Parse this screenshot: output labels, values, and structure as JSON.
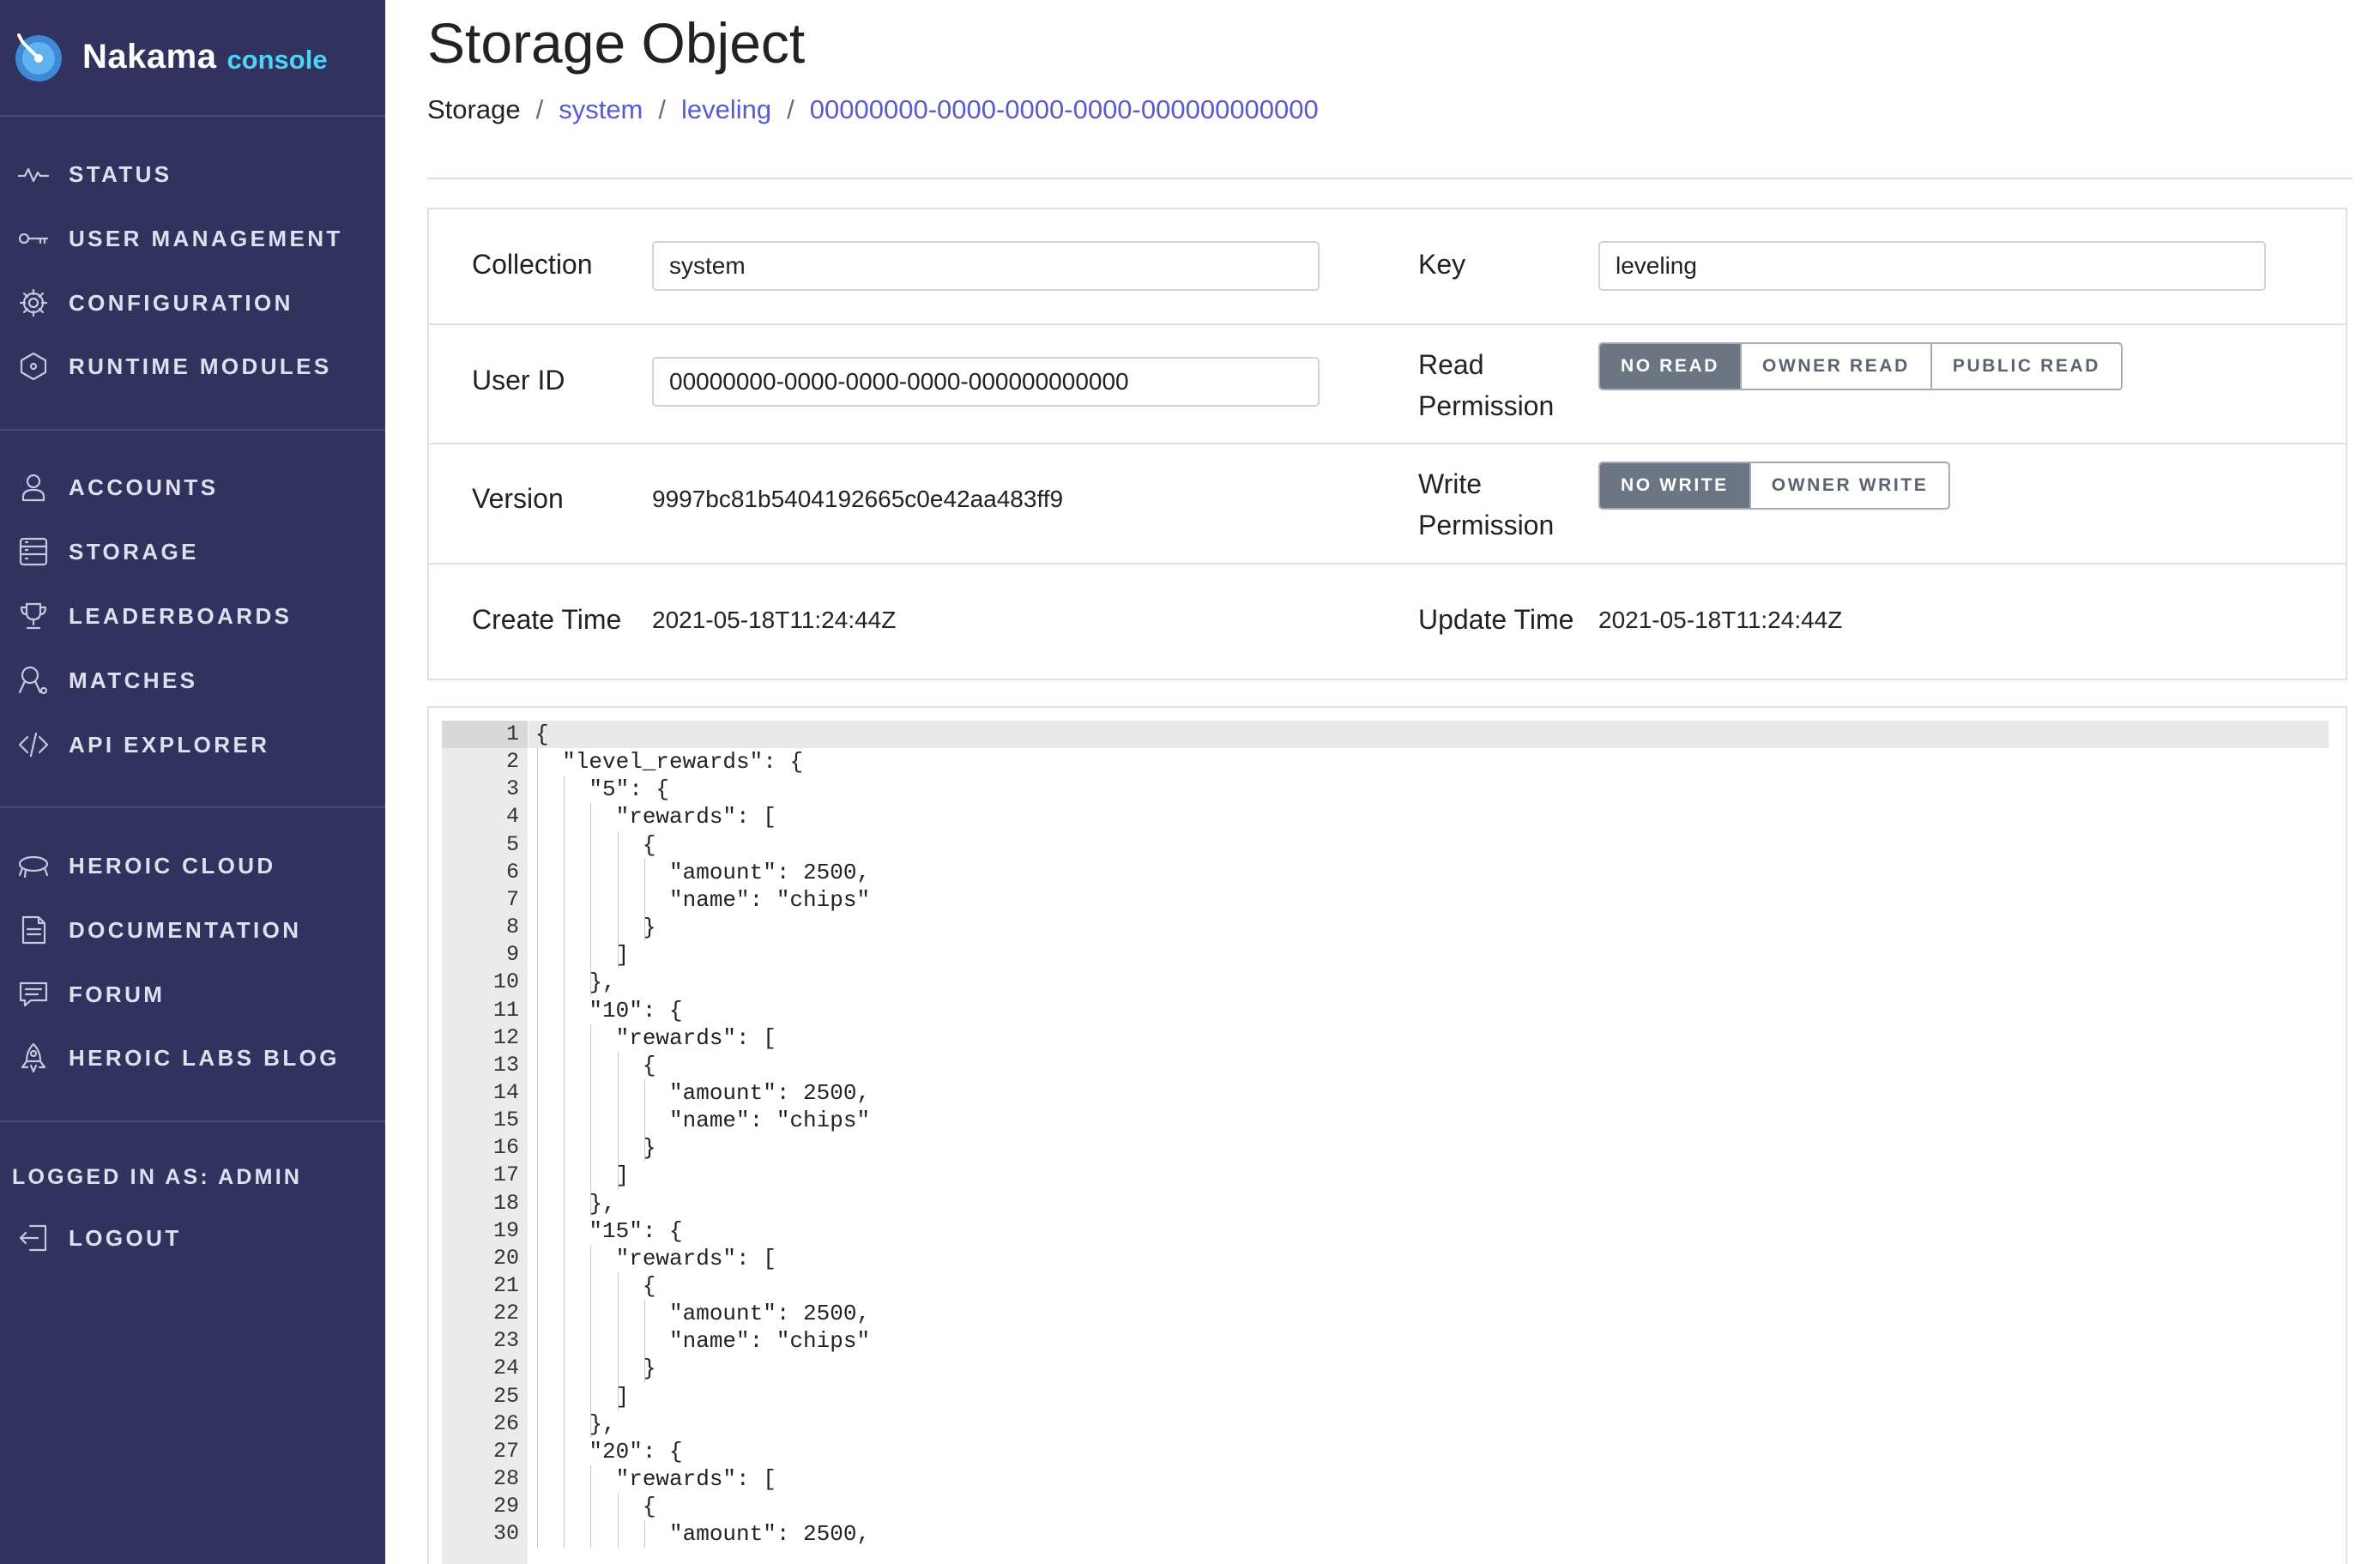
{
  "sidebar": {
    "brand_name": "Nakama",
    "brand_sub": "console",
    "nav_top": [
      {
        "label": "STATUS",
        "icon": "pulse-icon"
      },
      {
        "label": "USER MANAGEMENT",
        "icon": "key-icon"
      },
      {
        "label": "CONFIGURATION",
        "icon": "gear-icon"
      },
      {
        "label": "RUNTIME MODULES",
        "icon": "module-icon"
      }
    ],
    "nav_mid": [
      {
        "label": "ACCOUNTS",
        "icon": "user-icon"
      },
      {
        "label": "STORAGE",
        "icon": "storage-icon"
      },
      {
        "label": "LEADERBOARDS",
        "icon": "trophy-icon"
      },
      {
        "label": "MATCHES",
        "icon": "matches-icon"
      },
      {
        "label": "API EXPLORER",
        "icon": "code-icon"
      }
    ],
    "nav_links": [
      {
        "label": "HEROIC CLOUD",
        "icon": "cloud-icon"
      },
      {
        "label": "DOCUMENTATION",
        "icon": "document-icon"
      },
      {
        "label": "FORUM",
        "icon": "chat-icon"
      },
      {
        "label": "HEROIC LABS BLOG",
        "icon": "rocket-icon"
      }
    ],
    "logged_in": "LOGGED IN AS: ADMIN",
    "logout": "LOGOUT"
  },
  "page": {
    "title": "Storage Object",
    "breadcrumb": {
      "root": "Storage",
      "collection": "system",
      "key": "leveling",
      "user": "00000000-0000-0000-0000-000000000000",
      "separator": "/"
    }
  },
  "form": {
    "collection_label": "Collection",
    "collection_value": "system",
    "key_label": "Key",
    "key_value": "leveling",
    "user_id_label": "User ID",
    "user_id_value": "00000000-0000-0000-0000-000000000000",
    "read_permission_label": [
      "Read",
      "Permission"
    ],
    "read_options": [
      "NO READ",
      "OWNER READ",
      "PUBLIC READ"
    ],
    "read_selected": "NO READ",
    "version_label": "Version",
    "version_value": "9997bc81b5404192665c0e42aa483ff9",
    "write_permission_label": [
      "Write",
      "Permission"
    ],
    "write_options": [
      "NO WRITE",
      "OWNER WRITE"
    ],
    "write_selected": "NO WRITE",
    "create_time_label": "Create Time",
    "create_time_value": "2021-05-18T11:24:44Z",
    "update_time_label": "Update Time",
    "update_time_value": "2021-05-18T11:24:44Z"
  },
  "editor": {
    "lines": [
      "{",
      "  \"level_rewards\": {",
      "    \"5\": {",
      "      \"rewards\": [",
      "        {",
      "          \"amount\": 2500,",
      "          \"name\": \"chips\"",
      "        }",
      "      ]",
      "    },",
      "    \"10\": {",
      "      \"rewards\": [",
      "        {",
      "          \"amount\": 2500,",
      "          \"name\": \"chips\"",
      "        }",
      "      ]",
      "    },",
      "    \"15\": {",
      "      \"rewards\": [",
      "        {",
      "          \"amount\": 2500,",
      "          \"name\": \"chips\"",
      "        }",
      "      ]",
      "    },",
      "    \"20\": {",
      "      \"rewards\": [",
      "        {",
      "          \"amount\": 2500,"
    ]
  }
}
